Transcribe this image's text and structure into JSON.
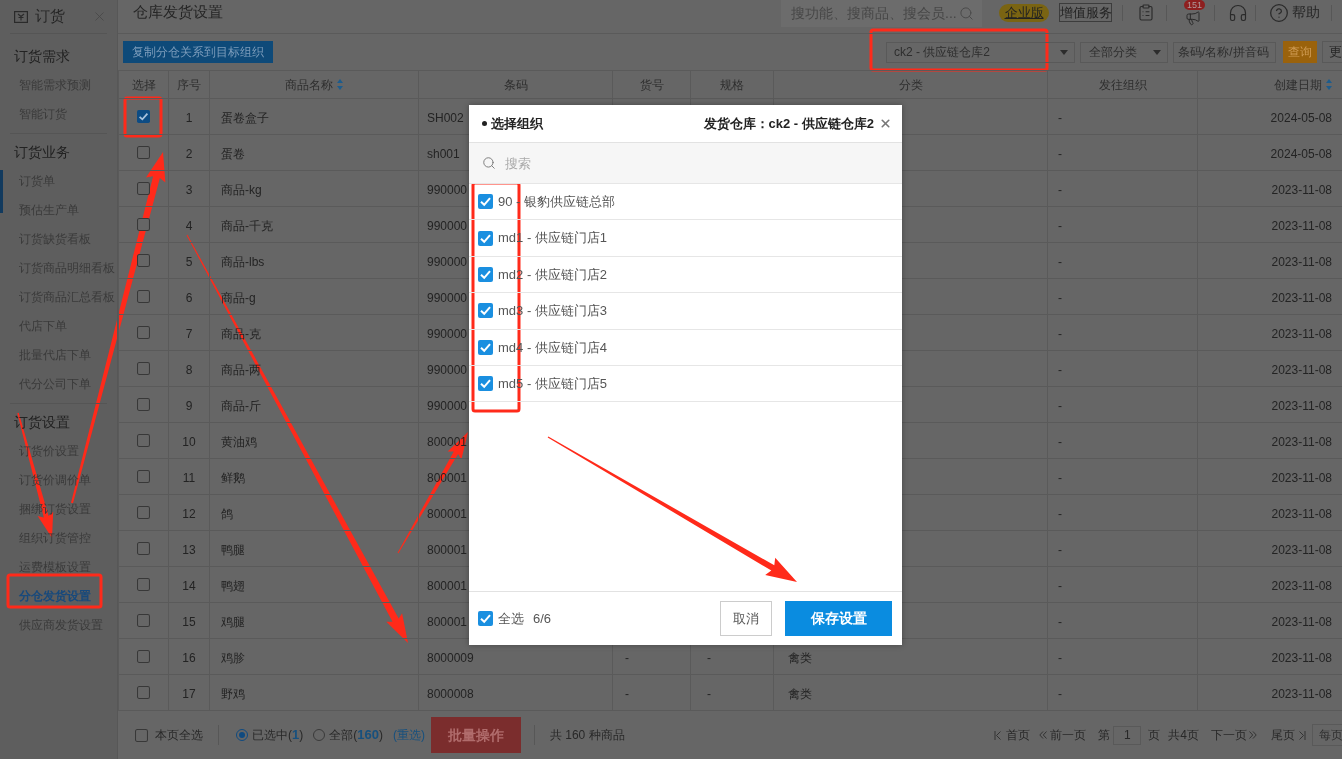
{
  "sidebar": {
    "title": "订货",
    "groups": [
      {
        "title": "订货需求",
        "items": [
          {
            "label": "智能需求预测",
            "selected": false
          },
          {
            "label": "智能订货",
            "selected": false
          }
        ]
      },
      {
        "title": "订货业务",
        "items": [
          {
            "label": "订货单",
            "selected": false
          },
          {
            "label": "预估生产单",
            "selected": false
          },
          {
            "label": "订货缺货看板",
            "selected": false
          },
          {
            "label": "订货商品明细看板",
            "selected": false
          },
          {
            "label": "订货商品汇总看板",
            "selected": false
          },
          {
            "label": "代店下单",
            "selected": false
          },
          {
            "label": "批量代店下单",
            "selected": false
          },
          {
            "label": "代分公司下单",
            "selected": false
          }
        ]
      },
      {
        "title": "订货设置",
        "items": [
          {
            "label": "订货价设置",
            "selected": false
          },
          {
            "label": "订货价调价单",
            "selected": false
          },
          {
            "label": "捆绑订货设置",
            "selected": false
          },
          {
            "label": "组织订货管控",
            "selected": false
          },
          {
            "label": "运费模板设置",
            "selected": false
          },
          {
            "label": "分仓发货设置",
            "selected": true
          },
          {
            "label": "供应商发货设置",
            "selected": false
          }
        ]
      }
    ]
  },
  "page_title": "仓库发货设置",
  "header": {
    "search": {
      "placeholder": "搜功能、搜商品、搜会员..."
    },
    "edition_badge": "企业版",
    "value_added_button": "增值服务",
    "notification_count": "151",
    "help": "帮助"
  },
  "toolbar": {
    "copy_button": "复制分仓关系到目标组织",
    "warehouse_select": "ck2 - 供应链仓库2",
    "category_select": "全部分类",
    "keyword_field": {
      "placeholder": "条码/名称/拼音码"
    },
    "query_button": "查询",
    "more_button": "更"
  },
  "table": {
    "columns": [
      {
        "label": "选择",
        "sortable": false
      },
      {
        "label": "序号",
        "sortable": false
      },
      {
        "label": "商品名称",
        "sortable": true
      },
      {
        "label": "条码",
        "sortable": false
      },
      {
        "label": "货号",
        "sortable": false
      },
      {
        "label": "规格",
        "sortable": false
      },
      {
        "label": "分类",
        "sortable": false
      },
      {
        "label": "发往组织",
        "sortable": false
      },
      {
        "label": "创建日期",
        "sortable": true
      }
    ],
    "rows": [
      {
        "checked": true,
        "no": "1",
        "name": "蛋卷盒子",
        "barcode": "SH002",
        "org": "-",
        "created": "2024-05-08"
      },
      {
        "checked": false,
        "no": "2",
        "name": "蛋卷",
        "barcode": "sh001",
        "org": "-",
        "created": "2024-05-08"
      },
      {
        "checked": false,
        "no": "3",
        "name": "商品-kg",
        "barcode": "990000",
        "org": "-",
        "created": "2023-11-08"
      },
      {
        "checked": false,
        "no": "4",
        "name": "商品-千克",
        "barcode": "990000",
        "org": "-",
        "created": "2023-11-08"
      },
      {
        "checked": false,
        "no": "5",
        "name": "商品-lbs",
        "barcode": "990000",
        "org": "-",
        "created": "2023-11-08"
      },
      {
        "checked": false,
        "no": "6",
        "name": "商品-g",
        "barcode": "990000",
        "org": "-",
        "created": "2023-11-08"
      },
      {
        "checked": false,
        "no": "7",
        "name": "商品-克",
        "barcode": "990000",
        "org": "-",
        "created": "2023-11-08"
      },
      {
        "checked": false,
        "no": "8",
        "name": "商品-两",
        "barcode": "990000",
        "org": "-",
        "created": "2023-11-08"
      },
      {
        "checked": false,
        "no": "9",
        "name": "商品-斤",
        "barcode": "990000",
        "org": "-",
        "created": "2023-11-08"
      },
      {
        "checked": false,
        "no": "10",
        "name": "黄油鸡",
        "barcode": "800001",
        "org": "-",
        "created": "2023-11-08"
      },
      {
        "checked": false,
        "no": "11",
        "name": "鲜鹅",
        "barcode": "800001",
        "org": "-",
        "created": "2023-11-08"
      },
      {
        "checked": false,
        "no": "12",
        "name": "鸽",
        "barcode": "800001",
        "org": "-",
        "created": "2023-11-08"
      },
      {
        "checked": false,
        "no": "13",
        "name": "鸭腿",
        "barcode": "800001",
        "org": "-",
        "created": "2023-11-08"
      },
      {
        "checked": false,
        "no": "14",
        "name": "鸭翅",
        "barcode": "800001",
        "org": "-",
        "created": "2023-11-08"
      },
      {
        "checked": false,
        "no": "15",
        "name": "鸡腿",
        "barcode": "800001",
        "org": "-",
        "created": "2023-11-08"
      },
      {
        "checked": false,
        "no": "16",
        "name": "鸡胗",
        "barcode": "8000009",
        "item_no": "-",
        "spec": "-",
        "category": "禽类",
        "org": "-",
        "created": "2023-11-08"
      },
      {
        "checked": false,
        "no": "17",
        "name": "野鸡",
        "barcode": "8000008",
        "item_no": "-",
        "spec": "-",
        "category": "禽类",
        "org": "-",
        "created": "2023-11-08"
      }
    ]
  },
  "footer": {
    "page_select_all": {
      "label": "本页全选",
      "checked": false
    },
    "scope": [
      {
        "label": "已选中(**1**)",
        "selected": true
      },
      {
        "label": "全部(**160**)",
        "selected": false
      }
    ],
    "reselect_link": "(重选)",
    "batch_button": "批量操作",
    "total": "共 160 种商品",
    "pagination": {
      "first": "首页",
      "prev": "前一页",
      "page_prefix": "第",
      "page_value": "1",
      "page_suffix": "页",
      "page_count": "共4页",
      "next": "下一页",
      "last": "尾页",
      "per_page": "每页"
    }
  },
  "dialog": {
    "title": "选择组织",
    "warehouse_label": "发货仓库：ck2 - 供应链仓库2",
    "search": {
      "placeholder": "搜索"
    },
    "options": [
      {
        "label": "90 - 银豹供应链总部",
        "checked": true
      },
      {
        "label": "md1 - 供应链门店1",
        "checked": true
      },
      {
        "label": "md2 - 供应链门店2",
        "checked": true
      },
      {
        "label": "md3 - 供应链门店3",
        "checked": true
      },
      {
        "label": "md4 - 供应链门店4",
        "checked": true
      },
      {
        "label": "md5 - 供应链门店5",
        "checked": true
      }
    ],
    "select_all": {
      "label": "全选",
      "checked": true
    },
    "count": "6/6",
    "buttons": [
      {
        "label": "取消",
        "kind": "secondary"
      },
      {
        "label": "保存设置",
        "kind": "primary"
      }
    ]
  }
}
